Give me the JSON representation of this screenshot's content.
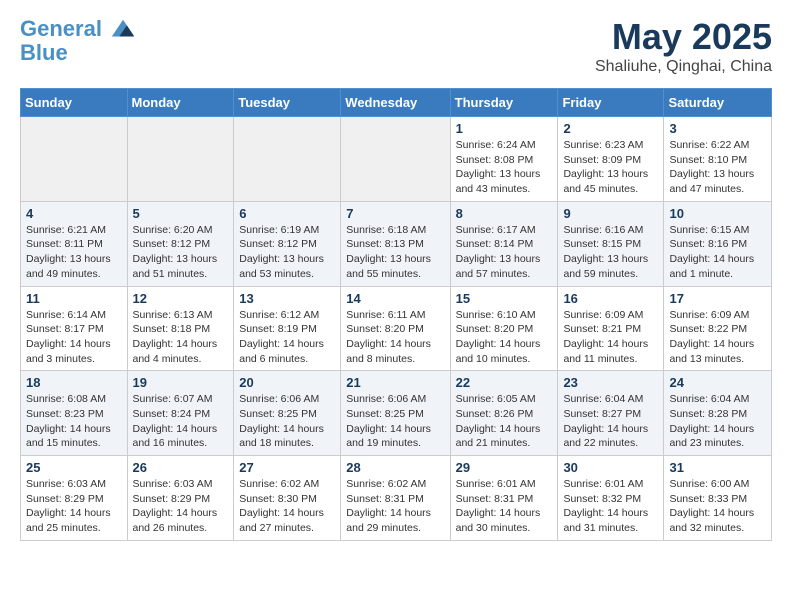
{
  "header": {
    "logo_line1": "General",
    "logo_line2": "Blue",
    "month": "May 2025",
    "location": "Shaliuhe, Qinghai, China"
  },
  "weekdays": [
    "Sunday",
    "Monday",
    "Tuesday",
    "Wednesday",
    "Thursday",
    "Friday",
    "Saturday"
  ],
  "weeks": [
    [
      {
        "day": "",
        "info": ""
      },
      {
        "day": "",
        "info": ""
      },
      {
        "day": "",
        "info": ""
      },
      {
        "day": "",
        "info": ""
      },
      {
        "day": "1",
        "info": "Sunrise: 6:24 AM\nSunset: 8:08 PM\nDaylight: 13 hours\nand 43 minutes."
      },
      {
        "day": "2",
        "info": "Sunrise: 6:23 AM\nSunset: 8:09 PM\nDaylight: 13 hours\nand 45 minutes."
      },
      {
        "day": "3",
        "info": "Sunrise: 6:22 AM\nSunset: 8:10 PM\nDaylight: 13 hours\nand 47 minutes."
      }
    ],
    [
      {
        "day": "4",
        "info": "Sunrise: 6:21 AM\nSunset: 8:11 PM\nDaylight: 13 hours\nand 49 minutes."
      },
      {
        "day": "5",
        "info": "Sunrise: 6:20 AM\nSunset: 8:12 PM\nDaylight: 13 hours\nand 51 minutes."
      },
      {
        "day": "6",
        "info": "Sunrise: 6:19 AM\nSunset: 8:12 PM\nDaylight: 13 hours\nand 53 minutes."
      },
      {
        "day": "7",
        "info": "Sunrise: 6:18 AM\nSunset: 8:13 PM\nDaylight: 13 hours\nand 55 minutes."
      },
      {
        "day": "8",
        "info": "Sunrise: 6:17 AM\nSunset: 8:14 PM\nDaylight: 13 hours\nand 57 minutes."
      },
      {
        "day": "9",
        "info": "Sunrise: 6:16 AM\nSunset: 8:15 PM\nDaylight: 13 hours\nand 59 minutes."
      },
      {
        "day": "10",
        "info": "Sunrise: 6:15 AM\nSunset: 8:16 PM\nDaylight: 14 hours\nand 1 minute."
      }
    ],
    [
      {
        "day": "11",
        "info": "Sunrise: 6:14 AM\nSunset: 8:17 PM\nDaylight: 14 hours\nand 3 minutes."
      },
      {
        "day": "12",
        "info": "Sunrise: 6:13 AM\nSunset: 8:18 PM\nDaylight: 14 hours\nand 4 minutes."
      },
      {
        "day": "13",
        "info": "Sunrise: 6:12 AM\nSunset: 8:19 PM\nDaylight: 14 hours\nand 6 minutes."
      },
      {
        "day": "14",
        "info": "Sunrise: 6:11 AM\nSunset: 8:20 PM\nDaylight: 14 hours\nand 8 minutes."
      },
      {
        "day": "15",
        "info": "Sunrise: 6:10 AM\nSunset: 8:20 PM\nDaylight: 14 hours\nand 10 minutes."
      },
      {
        "day": "16",
        "info": "Sunrise: 6:09 AM\nSunset: 8:21 PM\nDaylight: 14 hours\nand 11 minutes."
      },
      {
        "day": "17",
        "info": "Sunrise: 6:09 AM\nSunset: 8:22 PM\nDaylight: 14 hours\nand 13 minutes."
      }
    ],
    [
      {
        "day": "18",
        "info": "Sunrise: 6:08 AM\nSunset: 8:23 PM\nDaylight: 14 hours\nand 15 minutes."
      },
      {
        "day": "19",
        "info": "Sunrise: 6:07 AM\nSunset: 8:24 PM\nDaylight: 14 hours\nand 16 minutes."
      },
      {
        "day": "20",
        "info": "Sunrise: 6:06 AM\nSunset: 8:25 PM\nDaylight: 14 hours\nand 18 minutes."
      },
      {
        "day": "21",
        "info": "Sunrise: 6:06 AM\nSunset: 8:25 PM\nDaylight: 14 hours\nand 19 minutes."
      },
      {
        "day": "22",
        "info": "Sunrise: 6:05 AM\nSunset: 8:26 PM\nDaylight: 14 hours\nand 21 minutes."
      },
      {
        "day": "23",
        "info": "Sunrise: 6:04 AM\nSunset: 8:27 PM\nDaylight: 14 hours\nand 22 minutes."
      },
      {
        "day": "24",
        "info": "Sunrise: 6:04 AM\nSunset: 8:28 PM\nDaylight: 14 hours\nand 23 minutes."
      }
    ],
    [
      {
        "day": "25",
        "info": "Sunrise: 6:03 AM\nSunset: 8:29 PM\nDaylight: 14 hours\nand 25 minutes."
      },
      {
        "day": "26",
        "info": "Sunrise: 6:03 AM\nSunset: 8:29 PM\nDaylight: 14 hours\nand 26 minutes."
      },
      {
        "day": "27",
        "info": "Sunrise: 6:02 AM\nSunset: 8:30 PM\nDaylight: 14 hours\nand 27 minutes."
      },
      {
        "day": "28",
        "info": "Sunrise: 6:02 AM\nSunset: 8:31 PM\nDaylight: 14 hours\nand 29 minutes."
      },
      {
        "day": "29",
        "info": "Sunrise: 6:01 AM\nSunset: 8:31 PM\nDaylight: 14 hours\nand 30 minutes."
      },
      {
        "day": "30",
        "info": "Sunrise: 6:01 AM\nSunset: 8:32 PM\nDaylight: 14 hours\nand 31 minutes."
      },
      {
        "day": "31",
        "info": "Sunrise: 6:00 AM\nSunset: 8:33 PM\nDaylight: 14 hours\nand 32 minutes."
      }
    ]
  ]
}
